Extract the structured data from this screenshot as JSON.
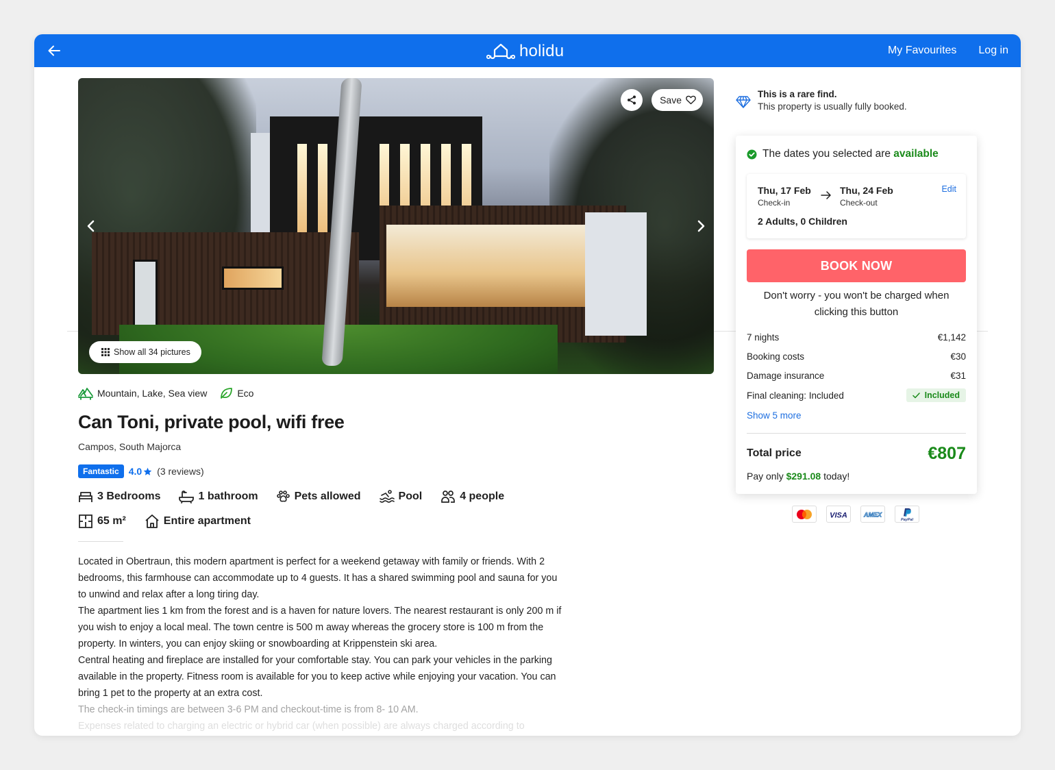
{
  "header": {
    "logo_text": "holidu",
    "nav": [
      "My Favourites",
      "Log in"
    ]
  },
  "gallery": {
    "save_label": "Save",
    "show_all_label": "Show all 34 pictures",
    "image_alt": "Modern house with dark timber cladding, large glass windows and a tall tree in the garden at dusk"
  },
  "property": {
    "tags": [
      {
        "icon": "mountain-view-icon",
        "label": "Mountain, Lake, Sea view"
      },
      {
        "icon": "leaf-icon",
        "label": "Eco"
      }
    ],
    "title": "Can Toni, private pool, wifi free",
    "location": "Campos, South Majorca",
    "rating_badge": "Fantastic",
    "rating_score": "4.0",
    "reviews": "(3 reviews)",
    "features": [
      {
        "icon": "bed-icon",
        "label": "3 Bedrooms"
      },
      {
        "icon": "bathtub-icon",
        "label": "1 bathroom"
      },
      {
        "icon": "paw-icon",
        "label": "Pets allowed"
      },
      {
        "icon": "swimmer-icon",
        "label": "Pool"
      },
      {
        "icon": "people-icon",
        "label": "4 people"
      },
      {
        "icon": "floorplan-icon",
        "label": "65 m²"
      },
      {
        "icon": "house-icon",
        "label": "Entire apartment"
      }
    ],
    "description": [
      "Located in Obertraun, this modern apartment is perfect for a weekend getaway with family or friends. With 2 bedrooms, this farmhouse can accommodate up to 4 guests. It has a shared swimming pool and sauna for you to unwind and relax after a long tiring day.",
      "The apartment lies 1 km from the forest and is a haven for nature lovers. The nearest restaurant is only 200 m if you wish to enjoy a local meal. The town centre is 500 m away whereas the grocery store is 100 m from the property. In winters, you can enjoy skiing or snowboarding at Krippenstein ski area.",
      "Central heating and fireplace are installed for your comfortable stay. You can park your vehicles in the parking available in the property. Fitness room is available for you to keep active while enjoying your vacation. You can bring 1 pet to the property at an extra cost.",
      "The check-in timings are between 3-6 PM and checkout-time is from 8- 10 AM.",
      "Expenses related to charging an electric or hybrid car (when possible) are always charged according to"
    ]
  },
  "rare_find": {
    "title": "This is a rare find.",
    "subtitle": "This property is usually fully booked."
  },
  "booking": {
    "availability_prefix": "The dates you selected are ",
    "availability_status": "available",
    "checkin_date": "Thu, 17 Feb",
    "checkin_label": "Check-in",
    "checkout_date": "Thu, 24 Feb",
    "checkout_label": "Check-out",
    "edit_label": "Edit",
    "guests": "2 Adults, 0 Children",
    "book_label": "BOOK NOW",
    "reassurance": "Don't worry - you won't be charged when clicking this button",
    "line_items": [
      {
        "label": "7 nights",
        "value": "€1,142"
      },
      {
        "label": "Booking costs",
        "value": "€30"
      },
      {
        "label": "Damage insurance",
        "value": "€31"
      },
      {
        "label": "Final cleaning: Included",
        "value": "Included"
      }
    ],
    "show_more_label": "Show 5 more",
    "total_label": "Total price",
    "total_value": "€807",
    "pay_prefix": "Pay only ",
    "pay_amount": "$291.08",
    "pay_suffix": " today!",
    "payment_methods": [
      "Mastercard",
      "VISA",
      "AMEX",
      "PayPal"
    ]
  },
  "colors": {
    "brand_blue": "#0f6fec",
    "book_button": "#ff6369",
    "success_green": "#1a8a1a",
    "link_blue": "#1e6fe0"
  }
}
